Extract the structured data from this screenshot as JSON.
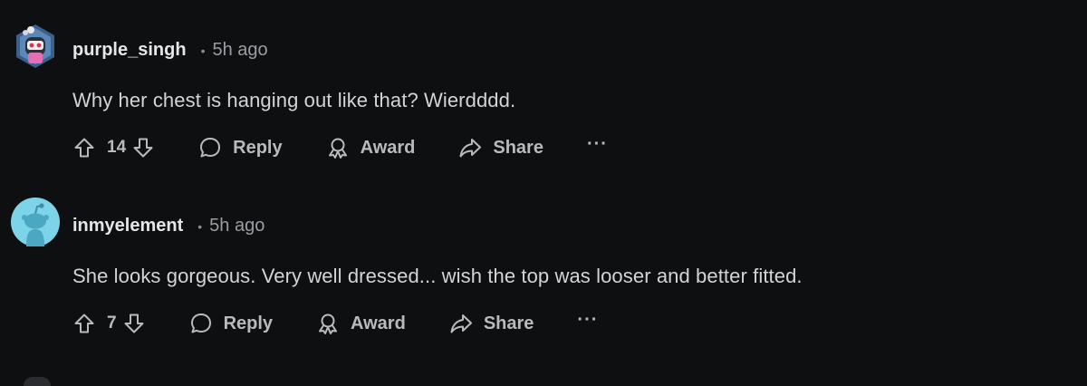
{
  "colors": {
    "background": "#0e0f11",
    "text": "#d7dadc",
    "muted": "#9a9ea2",
    "action": "#b8bbbe",
    "avatar2": "#7dd3e8"
  },
  "comments": [
    {
      "username": "purple_singh",
      "separator": "•",
      "time": "5h ago",
      "text": "Why her chest is hanging out like that? Wierdddd.",
      "votes": "14",
      "reply_label": "Reply",
      "award_label": "Award",
      "share_label": "Share",
      "more_label": "···",
      "avatar_icon": "custom-avatar-icon"
    },
    {
      "username": "inmyelement",
      "separator": "•",
      "time": "5h ago",
      "text": "She looks gorgeous. Very well dressed... wish the top was looser and better fitted.",
      "votes": "7",
      "reply_label": "Reply",
      "award_label": "Award",
      "share_label": "Share",
      "more_label": "···",
      "avatar_icon": "default-snoo-avatar-icon"
    }
  ]
}
